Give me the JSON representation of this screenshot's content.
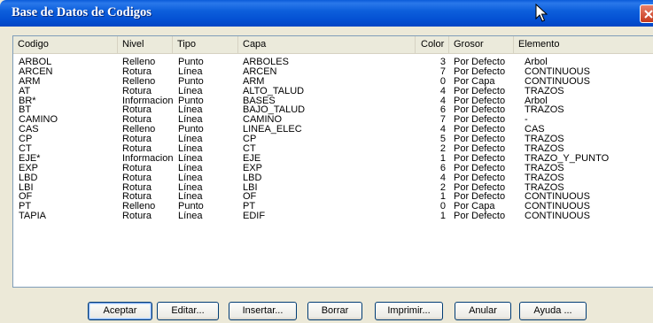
{
  "window": {
    "title": "Base de Datos de Codigos"
  },
  "columns": {
    "codigo": "Codigo",
    "nivel": "Nivel",
    "tipo": "Tipo",
    "capa": "Capa",
    "color": "Color",
    "grosor": "Grosor",
    "elemento": "Elemento"
  },
  "rows": [
    {
      "codigo": "ARBOL",
      "nivel": "Relleno",
      "tipo": "Punto",
      "capa": "ARBOLES",
      "color": "3",
      "grosor": "Por Defecto",
      "elemento": "Arbol"
    },
    {
      "codigo": "ARCEN",
      "nivel": "Rotura",
      "tipo": "Línea",
      "capa": "ARCEN",
      "color": "7",
      "grosor": "Por Defecto",
      "elemento": "CONTINUOUS"
    },
    {
      "codigo": "ARM",
      "nivel": "Relleno",
      "tipo": "Punto",
      "capa": "ARM",
      "color": "0",
      "grosor": "Por Capa",
      "elemento": "CONTINUOUS"
    },
    {
      "codigo": "AT",
      "nivel": "Rotura",
      "tipo": "Línea",
      "capa": "ALTO_TALUD",
      "color": "4",
      "grosor": "Por Defecto",
      "elemento": "TRAZOS"
    },
    {
      "codigo": "BR*",
      "nivel": "Informacion",
      "tipo": "Punto",
      "capa": "BASES",
      "color": "4",
      "grosor": "Por Defecto",
      "elemento": "Arbol"
    },
    {
      "codigo": "BT",
      "nivel": "Rotura",
      "tipo": "Línea",
      "capa": "BAJO_TALUD",
      "color": "6",
      "grosor": "Por Defecto",
      "elemento": "TRAZOS"
    },
    {
      "codigo": "CAMINO",
      "nivel": "Rotura",
      "tipo": "Línea",
      "capa": "CAMINO",
      "color": "7",
      "grosor": "Por Defecto",
      "elemento": "-"
    },
    {
      "codigo": "CAS",
      "nivel": "Relleno",
      "tipo": "Punto",
      "capa": "LINEA_ELEC",
      "color": "4",
      "grosor": "Por Defecto",
      "elemento": "CAS"
    },
    {
      "codigo": "CP",
      "nivel": "Rotura",
      "tipo": "Línea",
      "capa": "CP",
      "color": "5",
      "grosor": "Por Defecto",
      "elemento": "TRAZOS"
    },
    {
      "codigo": "CT",
      "nivel": "Rotura",
      "tipo": "Línea",
      "capa": "CT",
      "color": "2",
      "grosor": "Por Defecto",
      "elemento": "TRAZOS"
    },
    {
      "codigo": "EJE*",
      "nivel": "Informacion",
      "tipo": "Línea",
      "capa": "EJE",
      "color": "1",
      "grosor": "Por Defecto",
      "elemento": "TRAZO_Y_PUNTO"
    },
    {
      "codigo": "EXP",
      "nivel": "Rotura",
      "tipo": "Línea",
      "capa": "EXP",
      "color": "6",
      "grosor": "Por Defecto",
      "elemento": "TRAZOS"
    },
    {
      "codigo": "LBD",
      "nivel": "Rotura",
      "tipo": "Línea",
      "capa": "LBD",
      "color": "4",
      "grosor": "Por Defecto",
      "elemento": "TRAZOS"
    },
    {
      "codigo": "LBI",
      "nivel": "Rotura",
      "tipo": "Línea",
      "capa": "LBI",
      "color": "2",
      "grosor": "Por Defecto",
      "elemento": "TRAZOS"
    },
    {
      "codigo": "OF",
      "nivel": "Rotura",
      "tipo": "Línea",
      "capa": "OF",
      "color": "1",
      "grosor": "Por Defecto",
      "elemento": "CONTINUOUS"
    },
    {
      "codigo": "PT",
      "nivel": "Relleno",
      "tipo": "Punto",
      "capa": "PT",
      "color": "0",
      "grosor": "Por Capa",
      "elemento": "CONTINUOUS"
    },
    {
      "codigo": "TAPIA",
      "nivel": "Rotura",
      "tipo": "Línea",
      "capa": "EDIF",
      "color": "1",
      "grosor": "Por Defecto",
      "elemento": "CONTINUOUS"
    }
  ],
  "buttons": {
    "aceptar": "Aceptar",
    "editar": "Editar...",
    "insertar": "Insertar...",
    "borrar": "Borrar",
    "imprimir": "Imprimir...",
    "anular": "Anular",
    "ayuda": "Ayuda ..."
  },
  "icons": {
    "close": "close-icon",
    "cursor": "mouse-pointer-icon"
  },
  "colors": {
    "titlebar": "#0450d2",
    "close": "#d9492a",
    "dialog_bg": "#ece9d8"
  }
}
